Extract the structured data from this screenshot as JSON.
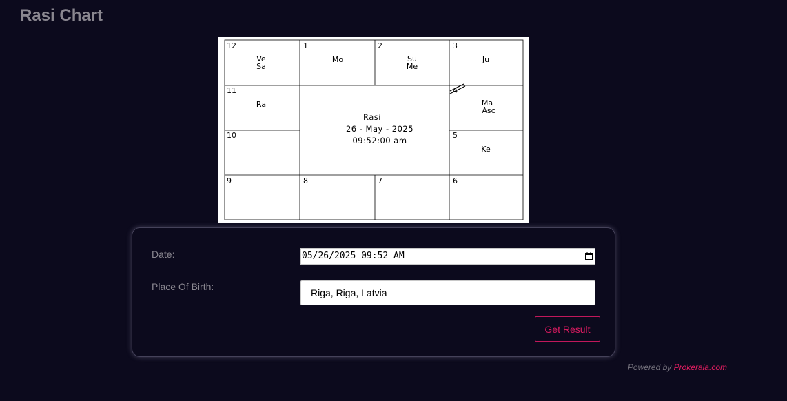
{
  "page": {
    "title": "Rasi Chart"
  },
  "chart": {
    "center": {
      "title": "Rasi",
      "date": "26 - May - 2025",
      "time": "09:52:00 am"
    },
    "cells": [
      {
        "num": "12",
        "planets": [
          "Ve",
          "Sa"
        ]
      },
      {
        "num": "1",
        "planets": [
          "Mo"
        ]
      },
      {
        "num": "2",
        "planets": [
          "Su",
          "Me"
        ]
      },
      {
        "num": "3",
        "planets": [
          "Ju"
        ]
      },
      {
        "num": "11",
        "planets": [
          "Ra"
        ]
      },
      {
        "num": "4",
        "planets": [
          "Ma",
          "Asc"
        ]
      },
      {
        "num": "10",
        "planets": []
      },
      {
        "num": "5",
        "planets": [
          "Ke"
        ]
      },
      {
        "num": "9",
        "planets": []
      },
      {
        "num": "8",
        "planets": []
      },
      {
        "num": "7",
        "planets": []
      },
      {
        "num": "6",
        "planets": []
      }
    ]
  },
  "form": {
    "date_label": "Date:",
    "date_value": "05/26/2025 09:52 AM",
    "place_label": "Place Of Birth:",
    "place_value": "Riga, Riga, Latvia",
    "submit_label": "Get Result"
  },
  "footer": {
    "powered_prefix": "Powered by",
    "powered_link": "Prokerala.com"
  }
}
